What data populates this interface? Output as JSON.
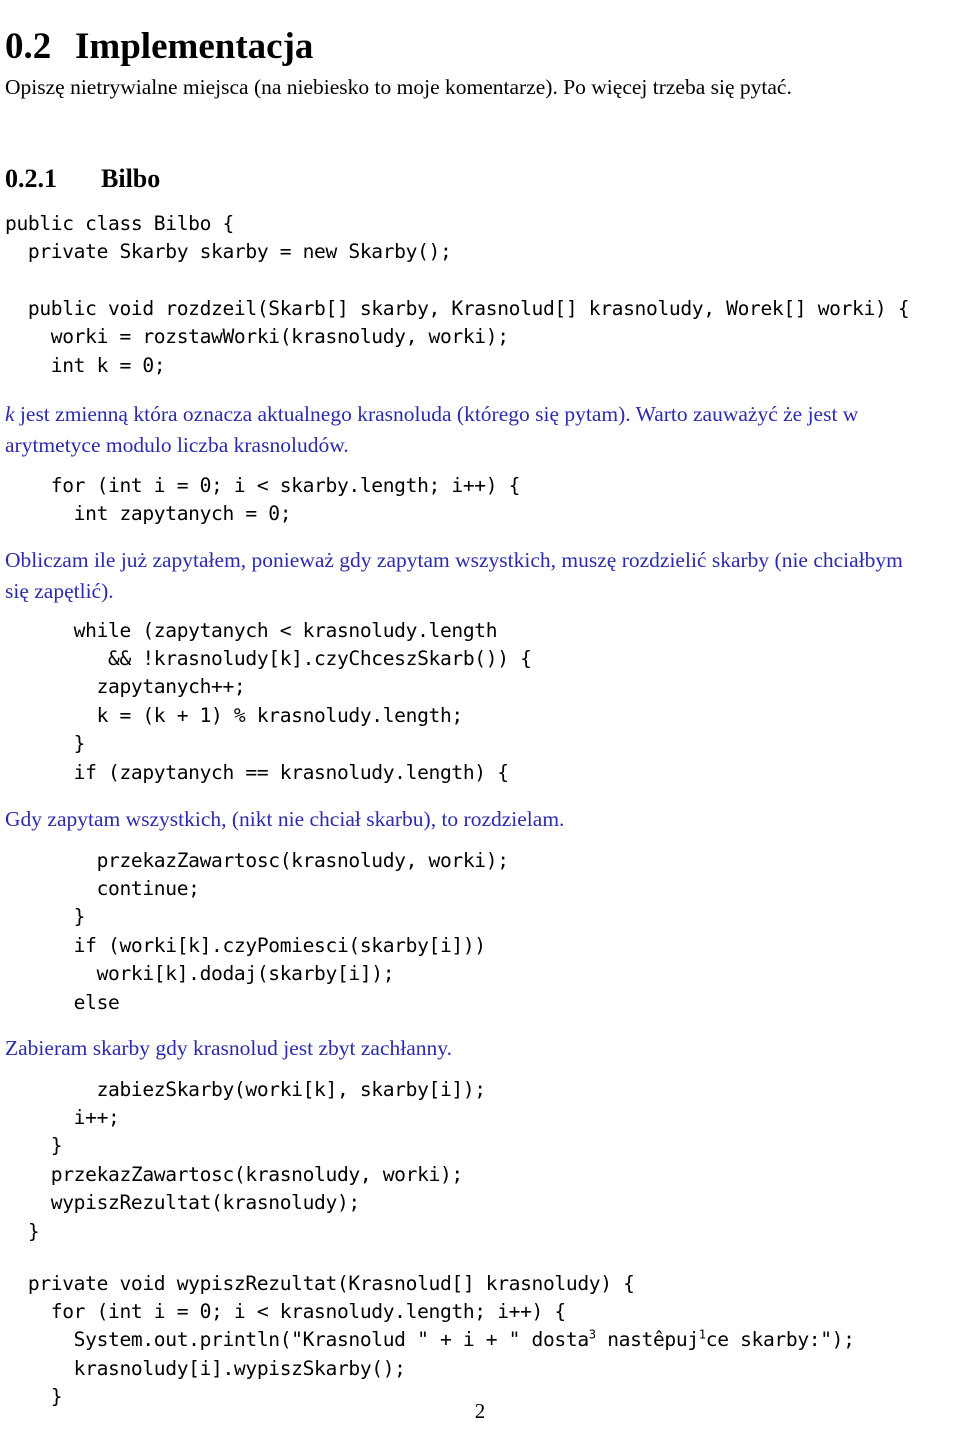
{
  "document": {
    "language": "pl",
    "page_number": "2",
    "accent_color": "#2b2bab"
  },
  "section": {
    "number": "0.2",
    "title": "Implementacja"
  },
  "intro_paragraph": "Opiszę nietrywialne miejsca (na niebiesko to moje komentarze). Po więcej trzeba się pytać.",
  "subsection": {
    "number": "0.2.1",
    "title": "Bilbo"
  },
  "blocks": {
    "code_1": "public class Bilbo {\n  private Skarby skarby = new Skarby();\n\n  public void rozdzeil(Skarb[] skarby, Krasnolud[] krasnoludy, Worek[] worki) {\n    worki = rozstawWorki(krasnoludy, worki);\n    int k = 0;",
    "comment_1_var": "k",
    "comment_1_rest": " jest zmienną która oznacza aktualnego krasnoluda (którego się pytam). Warto zauważyć że jest w arytmetyce modulo liczba krasnoludów.",
    "code_2": "    for (int i = 0; i < skarby.length; i++) {\n      int zapytanych = 0;",
    "comment_2": "Obliczam ile już zapytałem, ponieważ gdy zapytam wszystkich, muszę rozdzielić skarby (nie chciałbym się zapętlić).",
    "code_3": "      while (zapytanych < krasnoludy.length\n         && !krasnoludy[k].czyChceszSkarb()) {\n        zapytanych++;\n        k = (k + 1) % krasnoludy.length;\n      }\n      if (zapytanych == krasnoludy.length) {",
    "comment_3": "Gdy zapytam wszystkich, (nikt nie chciał skarbu), to rozdzielam.",
    "code_4": "        przekazZawartosc(krasnoludy, worki);\n        continue;\n      }\n      if (worki[k].czyPomiesci(skarby[i]))\n        worki[k].dodaj(skarby[i]);\n      else",
    "comment_4": "Zabieram skarby gdy krasnolud jest zbyt zachłanny.",
    "code_5": "        zabiezSkarby(worki[k], skarby[i]);\n      i++;\n    }\n    przekazZawartosc(krasnoludy, worki);\n    wypiszRezultat(krasnoludy);\n  }",
    "code_6_line1": "  private void wypiszRezultat(Krasnolud[] krasnoludy) {",
    "code_6_line2": "    for (int i = 0; i < krasnoludy.length; i++) {",
    "code_6_line3_a": "      System.out.println(\"Krasnolud \" + i + \" dosta",
    "code_6_line3_sup1": "3",
    "code_6_line3_b": " nastêpuj",
    "code_6_line3_sup2": "1",
    "code_6_line3_c": "ce skarby:\");",
    "code_6_line4": "      krasnoludy[i].wypiszSkarby();",
    "code_6_line5": "    }"
  }
}
